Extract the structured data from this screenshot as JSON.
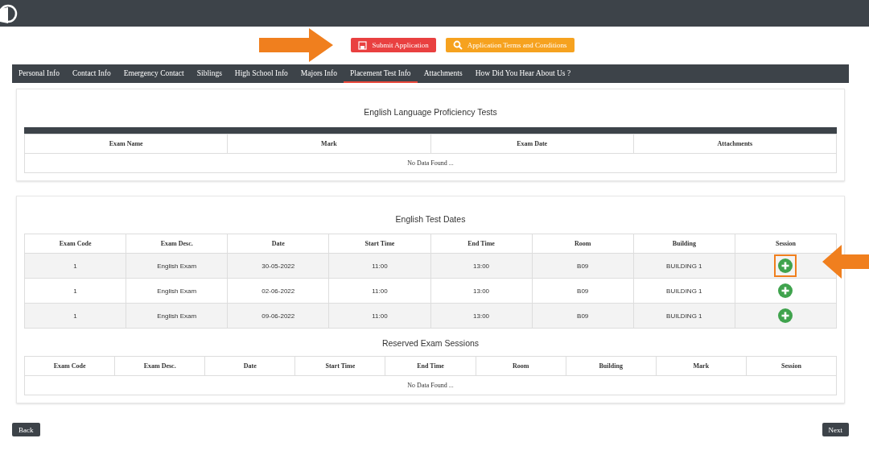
{
  "actions": [
    {
      "kind": "submit",
      "label": "Submit Application"
    },
    {
      "kind": "terms",
      "label": "Application Terms and Conditions"
    }
  ],
  "tabs": [
    {
      "label": "Personal Info",
      "selected": false
    },
    {
      "label": "Contact Info",
      "selected": false
    },
    {
      "label": "Emergency Contact",
      "selected": false
    },
    {
      "label": "Siblings",
      "selected": false
    },
    {
      "label": "High School Info",
      "selected": false
    },
    {
      "label": "Majors Info",
      "selected": false
    },
    {
      "label": "Placement Test Info",
      "selected": true
    },
    {
      "label": "Attachments",
      "selected": false
    },
    {
      "label": "How Did You Hear About Us ?",
      "selected": false
    }
  ],
  "proficiency": {
    "title": "English Language Proficiency Tests",
    "columns": [
      "Exam Name",
      "Mark",
      "Exam Date",
      "Attachments"
    ],
    "empty": "No Data Found ..."
  },
  "test_dates": {
    "title": "English Test Dates",
    "columns": [
      "Exam Code",
      "Exam Desc.",
      "Date",
      "Start Time",
      "End Time",
      "Room",
      "Building",
      "Session"
    ],
    "rows": [
      {
        "cells": [
          "1",
          "English Exam",
          "30-05-2022",
          "11:00",
          "13:00",
          "B09",
          "BUILDING 1"
        ],
        "highlighted": true
      },
      {
        "cells": [
          "1",
          "English Exam",
          "02-06-2022",
          "11:00",
          "13:00",
          "B09",
          "BUILDING 1"
        ],
        "highlighted": false
      },
      {
        "cells": [
          "1",
          "English Exam",
          "09-06-2022",
          "11:00",
          "13:00",
          "B09",
          "BUILDING 1"
        ],
        "highlighted": false
      }
    ]
  },
  "reserved": {
    "title": "Reserved Exam Sessions",
    "columns": [
      "Exam Code",
      "Exam Desc.",
      "Date",
      "Start Time",
      "End Time",
      "Room",
      "Building",
      "Mark",
      "Session"
    ],
    "empty": "No Data Found ..."
  },
  "nav": {
    "back": "Back",
    "next": "Next"
  }
}
